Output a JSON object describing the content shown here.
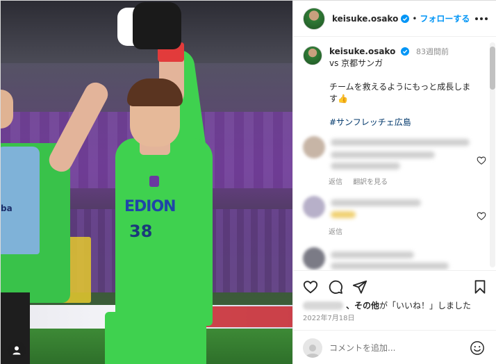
{
  "post": {
    "username": "keisuke.osako",
    "follow_label": "フォローする",
    "separator": "•",
    "time_ago": "83週間前",
    "caption_line1": "vs 京都サンガ",
    "caption_line2": "チームを救えるようにもっと成長しま\nす👍",
    "hashtag": "#サンフレッチェ広島",
    "photo": {
      "number": "38",
      "sponsor": "EDION",
      "teammate_sponsor": "ba"
    }
  },
  "comments": [
    {
      "reply_label": "返信",
      "translate_label": "翻訳を見る"
    },
    {
      "reply_label": "返信"
    }
  ],
  "likes": {
    "suffix_bold": "、その他",
    "suffix_text": "が「いいね！」しました"
  },
  "date": "2022年7月18日",
  "comment_input": {
    "placeholder": "コメントを追加..."
  },
  "icons": [
    "verified-icon",
    "more-options-icon",
    "heart-icon",
    "comment-icon",
    "share-icon",
    "bookmark-icon",
    "emoji-icon",
    "user-profile-icon"
  ],
  "colors": {
    "accent": "#0095f6",
    "hashtag": "#00376b",
    "muted": "#8e8e8e"
  }
}
